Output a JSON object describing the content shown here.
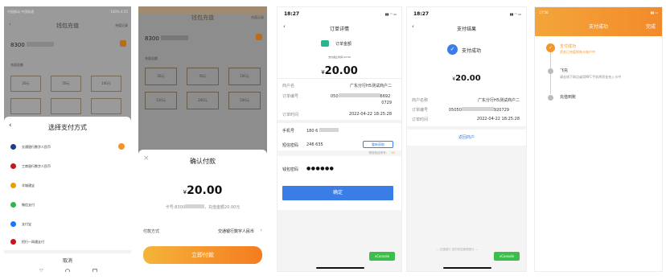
{
  "screen1": {
    "status_left": "中国移动 中国联通",
    "status_right": "100% 4:55",
    "nav_title": "钱包充值",
    "nav_right": "充值记录",
    "card_number": "8300",
    "section_label": "充值金额",
    "amounts": [
      "20元",
      "50元",
      "100元"
    ],
    "sheet_title": "选择支付方式",
    "methods": [
      "交通银行数字人民币",
      "工商银行数字人民币",
      "羊城通宝",
      "微信支付",
      "支付宝",
      "招行一网通支付"
    ],
    "cancel": "取消"
  },
  "screen2": {
    "nav_title": "钱包充值",
    "nav_right": "充值记录",
    "card_number": "8300",
    "section_label": "充值金额",
    "amounts_row1": [
      "20元",
      "50元",
      "100元"
    ],
    "amounts_row2": [
      "150元",
      "200元",
      "500元"
    ],
    "sheet_title": "确认付款",
    "currency": "¥",
    "amount": "20.00",
    "detail_prefix": "卡号:8300",
    "detail_suffix": "，充值金额20.00元",
    "method_label": "付款方式",
    "method_value": "交通银行数字人民币",
    "pay_button": "立即付款"
  },
  "screen3": {
    "time": "18:27",
    "nav_title": "订单详情",
    "merchant_header": "订单金额",
    "sub_caption": "支付截止时间 03:00",
    "currency": "¥",
    "amount": "20.00",
    "rows": [
      {
        "label": "商户名",
        "value": "广东分行H5测试商户二"
      },
      {
        "label": "订单编号",
        "value": "050",
        "value2": "6692",
        "value3": "0729"
      },
      {
        "label": "订单时间",
        "value": "2022-04-22 18:25:28"
      }
    ],
    "phone_label": "手机号",
    "phone_value": "180 6",
    "sms_label": "短信密码",
    "sms_value": "246 635",
    "resend": "重新获取",
    "sms_hint": "短信验证序号：",
    "sms_seq": "01",
    "wallet_label": "钱包密码",
    "wallet_value": "●●●●●●",
    "confirm": "确定",
    "vconsole": "vConsole"
  },
  "screen4": {
    "time": "18:27",
    "nav_title": "支付结果",
    "status": "支付成功",
    "currency": "¥",
    "amount": "20.00",
    "rows": [
      {
        "label": "商户名称",
        "value": "广东分行H5测试商户二"
      },
      {
        "label": "订单编号",
        "value": "05050",
        "value2": "920729"
      },
      {
        "label": "订单时间",
        "value": "2022-04-22 18:25:28"
      }
    ],
    "return_link": "返回商户",
    "footer": "— 交通银行 您的财富管理银行 —",
    "vconsole": "vConsole"
  },
  "screen5": {
    "status_left": "17:56",
    "nav_title": "支付成功",
    "nav_right": "完成",
    "steps": [
      {
        "title": "支付成功",
        "desc": "资金已充值到账卡账户中"
      },
      {
        "title": "飞充",
        "desc": "请去线下网点或用NFC手机将资金充入卡中"
      },
      {
        "title": "充值到账",
        "desc": ""
      }
    ]
  },
  "colors": {
    "orange": "#f3962a",
    "blue": "#3a7de6",
    "green_vconsole": "#3cbf4a"
  }
}
